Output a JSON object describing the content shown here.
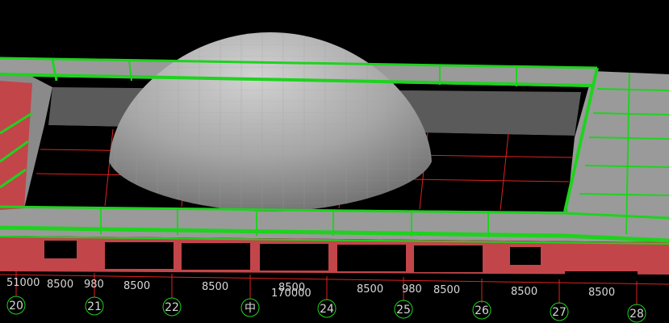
{
  "viewport": {
    "colors": {
      "background": "#000000",
      "roof_panel": "#9a9a9a",
      "beam": "#1fd21f",
      "wall": "#c2454a",
      "grid_line": "#e02020",
      "dome": "#a8a8a8",
      "axis_text": "#d8d8d8"
    }
  },
  "dimensions": {
    "d1": "51000",
    "d2": "8500",
    "d3": "980",
    "d4": "8500",
    "d5": "8500",
    "d6": "8500",
    "d6b": "170000",
    "d7": "8500",
    "d8": "980",
    "d9": "8500",
    "d10": "8500",
    "d11": "8500"
  },
  "axes": {
    "a20": "20",
    "a21": "21",
    "a22": "22",
    "a23": "中",
    "a24": "24",
    "a25": "25",
    "a26": "26",
    "a27": "27",
    "a28": "28"
  }
}
